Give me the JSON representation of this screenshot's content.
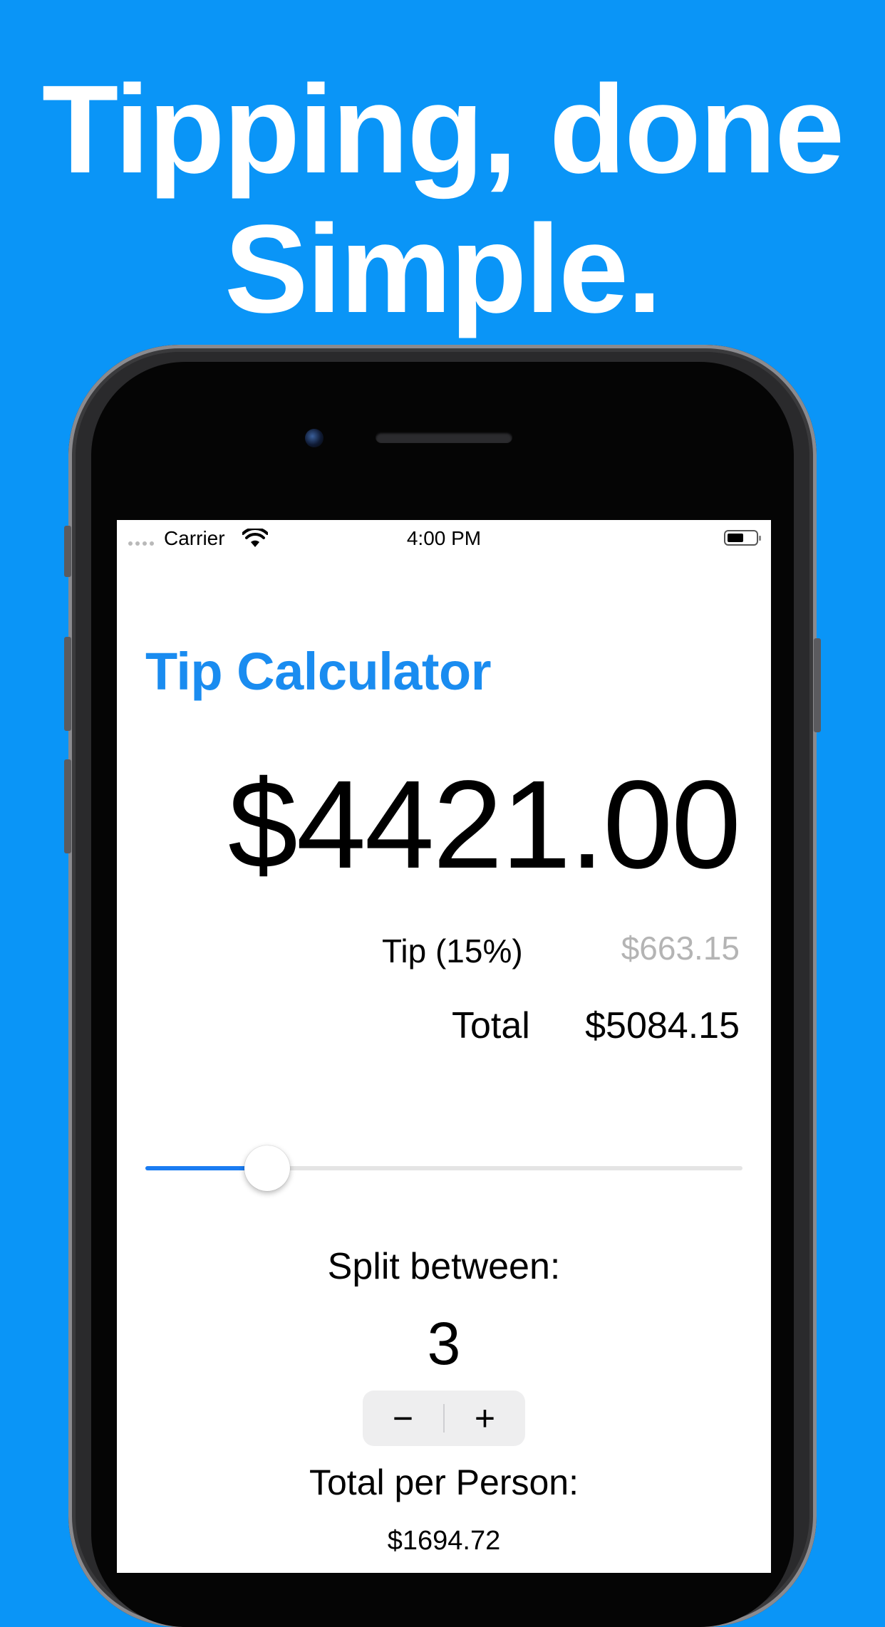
{
  "headline": {
    "line1": "Tipping, done",
    "line2": "Simple."
  },
  "status_bar": {
    "carrier": "Carrier",
    "time": "4:00 PM"
  },
  "app": {
    "title": "Tip Calculator",
    "bill_amount": "$4421.00",
    "tip": {
      "label": "Tip  (15%)",
      "value": "$663.15"
    },
    "total": {
      "label": "Total",
      "value": "$5084.15"
    },
    "slider": {
      "value_fraction": 0.18
    },
    "split": {
      "label": "Split between:",
      "count": "3",
      "decrement": "−",
      "increment": "+"
    },
    "per_person": {
      "label": "Total per Person:",
      "value": "$1694.72"
    }
  },
  "colors": {
    "background": "#0a95f7",
    "title": "#1a8cf0",
    "slider_fill": "#1a7cf2",
    "tip_value": "#b4b4b4"
  },
  "icons": [
    "wifi-icon",
    "battery-icon",
    "signal-icon",
    "minus-icon",
    "plus-icon"
  ]
}
